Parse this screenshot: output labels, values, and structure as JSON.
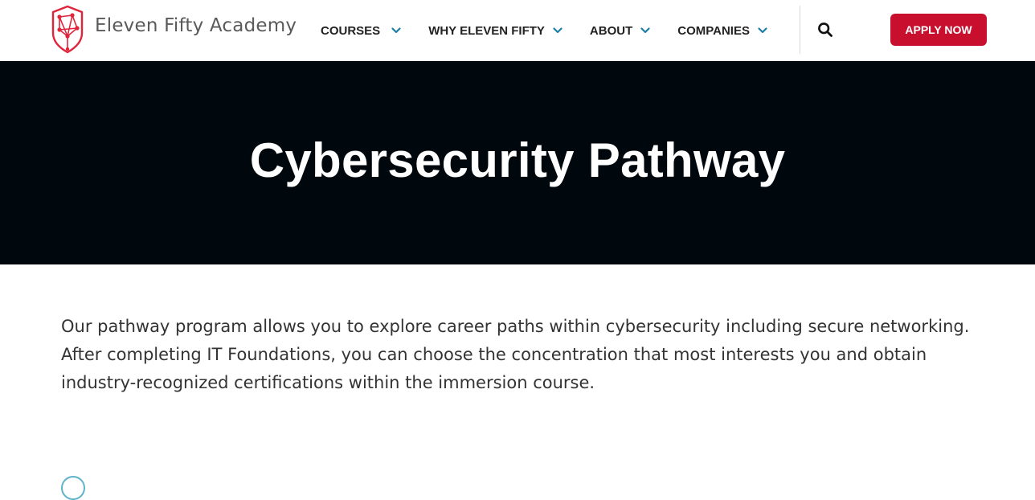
{
  "header": {
    "logo_text": "Eleven Fifty Academy",
    "nav": [
      {
        "label": "COURSES"
      },
      {
        "label": "WHY ELEVEN FIFTY"
      },
      {
        "label": "ABOUT"
      },
      {
        "label": "COMPANIES"
      }
    ],
    "apply_label": "APPLY NOW"
  },
  "hero": {
    "title": "Cybersecurity Pathway"
  },
  "main": {
    "intro": "Our pathway program allows you to explore career paths within cybersecurity including secure networking. After completing IT Foundations, you can choose the concentration that most interests you and obtain industry-recognized certifications within the immersion course."
  },
  "colors": {
    "brand_red": "#c8102e",
    "hero_bg": "#01080d",
    "chevron_accent": "#1b7fa6"
  }
}
